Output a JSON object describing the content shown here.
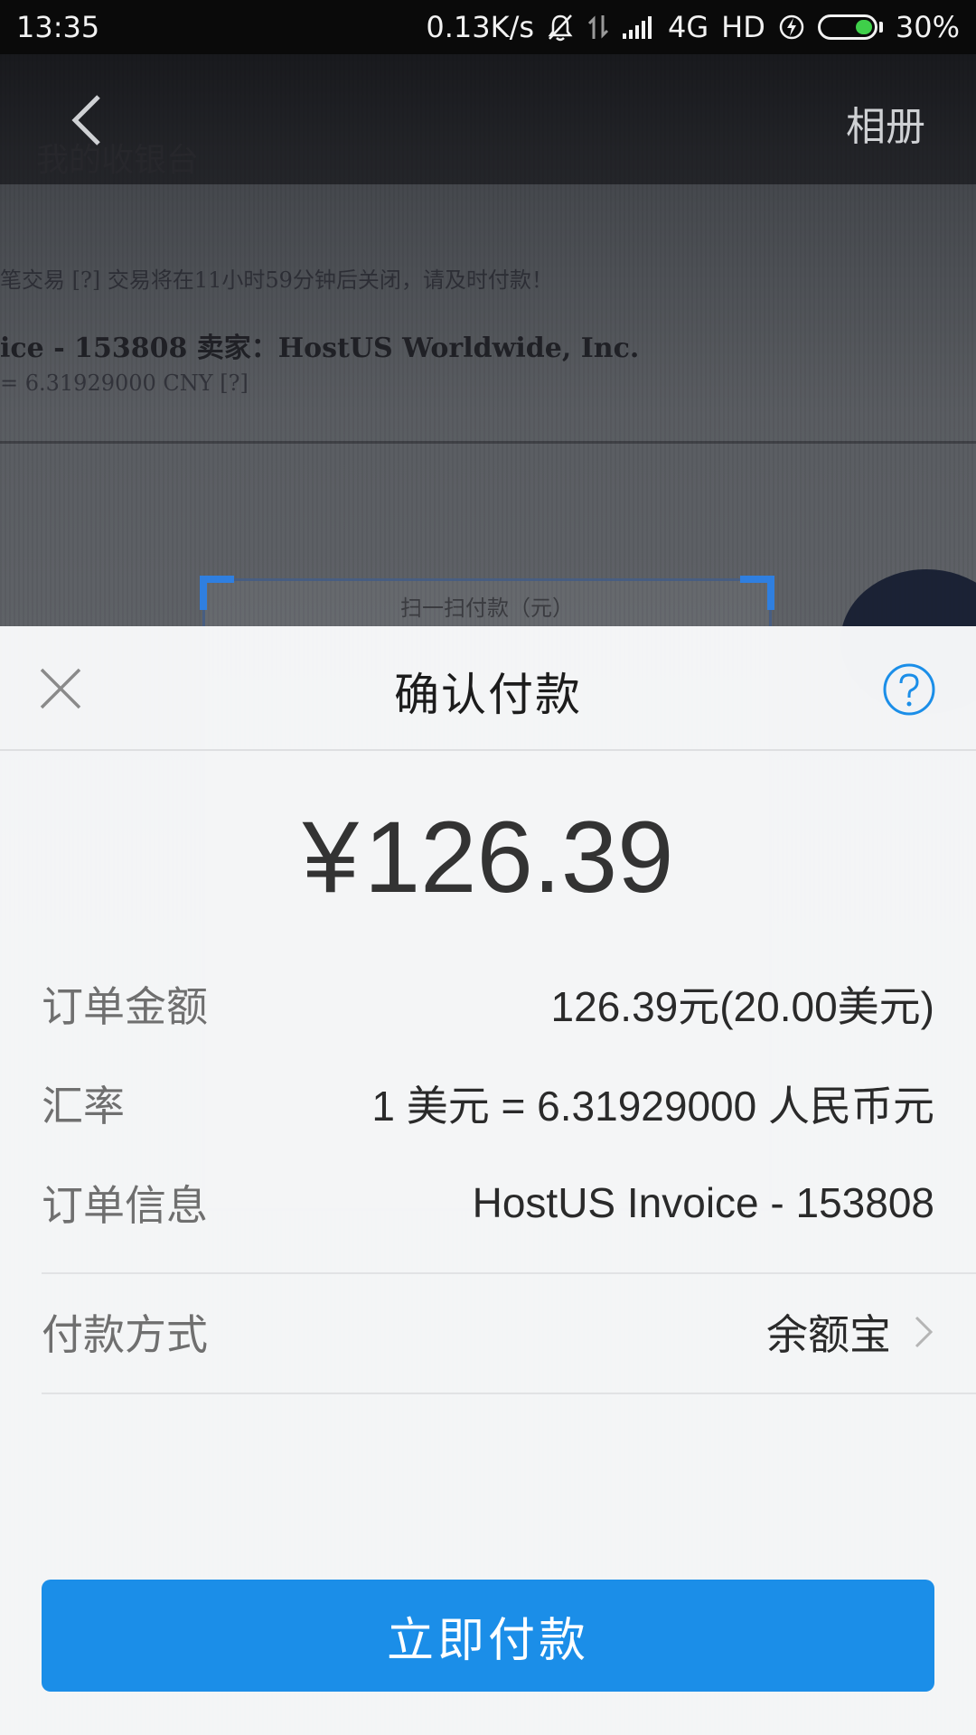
{
  "status_bar": {
    "time": "13:35",
    "net_speed": "0.13K/s",
    "network": "4G",
    "hd": "HD",
    "battery": "30%",
    "battery_level": 0.3,
    "battery_color": "#3fcf4a"
  },
  "camera_view": {
    "title": "我的收银台",
    "line1": "笔交易 [?]   交易将在11小时59分钟后关闭，请及时付款！",
    "line2": "ice - 153808   卖家：HostUS Worldwide, Inc.",
    "line3": "= 6.31929000 CNY [?]",
    "scan_label": "扫一扫付款（元）"
  },
  "nav": {
    "album_label": "相册"
  },
  "sheet": {
    "title": "确认付款",
    "amount_currency": "¥",
    "amount_value": "126.39",
    "rows": {
      "order_amount": {
        "label": "订单金额",
        "value": "126.39元(20.00美元)"
      },
      "exchange_rate": {
        "label": "汇率",
        "value": "1 美元 = 6.31929000 人民币元"
      },
      "order_info": {
        "label": "订单信息",
        "value": "HostUS Invoice - 153808"
      },
      "payment_method": {
        "label": "付款方式",
        "value": "余额宝"
      }
    },
    "pay_button": "立即付款",
    "accent_color": "#1b8ee8"
  }
}
